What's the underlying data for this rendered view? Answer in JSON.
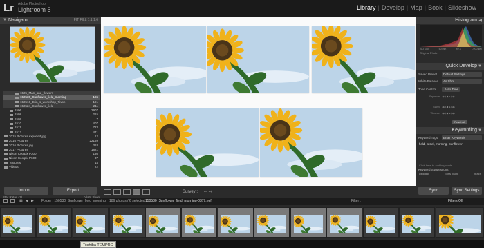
{
  "app": {
    "logo": "Lr",
    "company": "Adobe Photoshop",
    "name": "Lightroom 5"
  },
  "modules": [
    "Library",
    "Develop",
    "Map",
    "Book",
    "Slideshow"
  ],
  "active_module": "Library",
  "navigator": {
    "title": "Navigator",
    "zoom_options": "FIT  FILL  1:1  1:6"
  },
  "folders": [
    {
      "name": "1505_Man_and_flowers",
      "count": "",
      "state": "normal"
    },
    {
      "name": "150530_Sunflower_field_morning",
      "count": "186",
      "state": "selected"
    },
    {
      "name": "150516_Erin_s_workshop_Tivon",
      "count": "191",
      "state": "normal"
    },
    {
      "name": "150524_Sunflower_field",
      "count": "211",
      "state": "normal"
    },
    {
      "name": "1506",
      "count": "2907",
      "state": "normal"
    },
    {
      "name": "1508",
      "count": "215",
      "state": "normal"
    },
    {
      "name": "1509",
      "count": "7",
      "state": "normal"
    },
    {
      "name": "1510",
      "count": "407",
      "state": "normal"
    },
    {
      "name": "1511",
      "count": "723",
      "state": "normal"
    },
    {
      "name": "1512",
      "count": "471",
      "state": "normal"
    },
    {
      "name": "2015 Pictures exported jpg",
      "count": "12",
      "state": "normal"
    },
    {
      "name": "2016 Pictures",
      "count": "22159",
      "state": "normal"
    },
    {
      "name": "2016 Pictures jpg",
      "count": "318",
      "state": "normal"
    },
    {
      "name": "2017 Pictures",
      "count": "1821",
      "state": "normal"
    },
    {
      "name": "Nikon Coolpix P300",
      "count": "136",
      "state": "normal"
    },
    {
      "name": "Nikon Coolpix P600",
      "count": "37",
      "state": "normal"
    },
    {
      "name": "Textures",
      "count": "14",
      "state": "normal"
    },
    {
      "name": "Videos",
      "count": "22",
      "state": "normal"
    }
  ],
  "star_row": {
    "left": "Star Rates (1)",
    "right": "Vista Shop"
  },
  "left_buttons": {
    "import": "Import...",
    "export": "Export..."
  },
  "toolbar": {
    "survey_label": "Survey :",
    "arrows": "⇦ ⇨"
  },
  "histogram": {
    "title": "Histogram",
    "values": [
      "ISO 100",
      "50 mm",
      "f/7.1",
      "1/200 sec"
    ],
    "original_photo": "Original Photo"
  },
  "quick_develop": {
    "title": "Quick Develop",
    "saved_preset_label": "Saved Preset",
    "saved_preset_value": "Default Settings",
    "white_balance_label": "White Balance",
    "white_balance_value": "As Shot",
    "tone_control_label": "Tone Control",
    "tone_control_value": "Auto Tone",
    "exposure_label": "Exposure",
    "clarity_label": "Clarity",
    "vibrance_label": "Vibrance",
    "reset_label": "Reset All"
  },
  "keywording": {
    "title": "Keywording",
    "tags_label": "Keyword Tags",
    "tags_value": "Enter Keywords",
    "text": "field, israel, morning, Sunflower",
    "hint": "Click here to add keywords",
    "suggestions_label": "Keyword Suggestions",
    "suggestions": [
      "wedding",
      "Erins Trunk",
      "beach"
    ]
  },
  "right_buttons": {
    "sync": "Sync",
    "sync_settings": "Sync Settings"
  },
  "filmstrip": {
    "page_numbers": [
      "1",
      "2"
    ],
    "folder_label": "Folder : 150530_Sunflower_field_morning",
    "photo_count": "186 photos / 6 selected",
    "filename": "150530_Sunflower_field_morning-0377.nef",
    "filter_label": "Filter :",
    "filters_off": "Filters Off"
  },
  "tooltip": "Toshiba TEMPRO",
  "colors": {
    "sky": "#bcd4e8",
    "petal": "#f0b21a",
    "center": "#4a3418",
    "leaf": "#2f6a2a",
    "accent_active": "#ffffff"
  }
}
